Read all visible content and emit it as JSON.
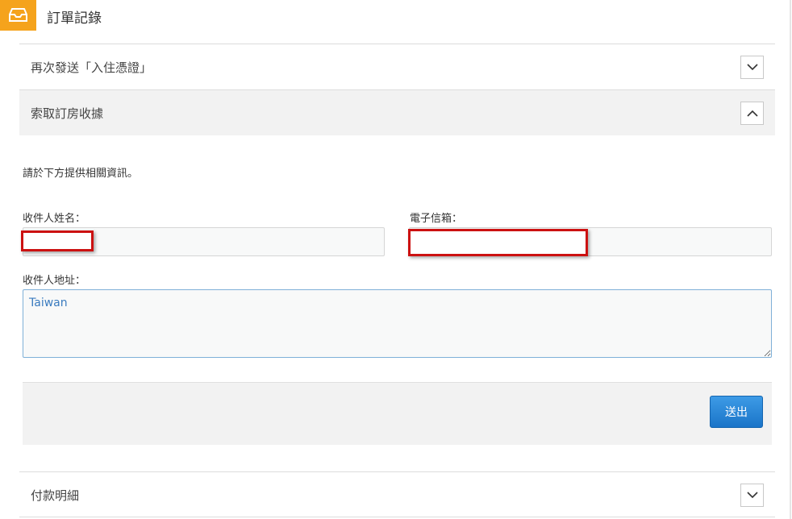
{
  "header": {
    "title": "訂單記錄",
    "icon": "inbox-icon",
    "accent": "#f5a31c"
  },
  "sections": {
    "resend": {
      "label": "再次發送「入住憑證」",
      "toggle_icon": "chevron-down-icon"
    },
    "receipt": {
      "label": "索取訂房收據",
      "toggle_icon": "chevron-up-icon"
    },
    "payment": {
      "label": "付款明細",
      "toggle_icon": "chevron-down-icon"
    }
  },
  "form": {
    "intro": "請於下方提供相關資訊。",
    "name_label": "收件人姓名：",
    "name_value": "",
    "email_label": "電子信箱：",
    "email_value": "",
    "address_label": "收件人地址：",
    "address_value": "Taiwan",
    "submit_label": "送出",
    "submit_color": "#1a74c8"
  }
}
